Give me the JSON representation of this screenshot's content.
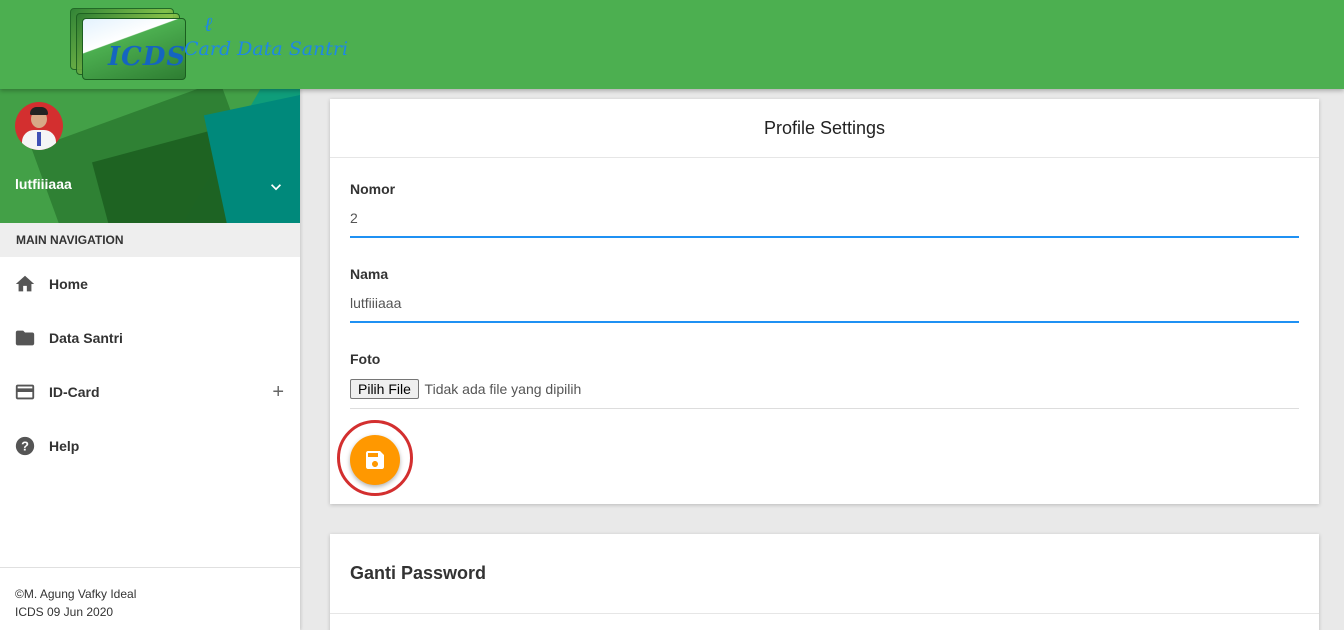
{
  "brand": {
    "logo_main": "ICDS",
    "logo_script": "Card Data Santri",
    "colors": {
      "topbar": "#4caf50",
      "accent": "#1f91f3",
      "fab": "#ff9800",
      "highlight_ring": "#d32f2f"
    }
  },
  "user": {
    "name": "lutfiiiaaa",
    "avatar_icon": "user-photo",
    "toggle_icon": "chevron-down-icon"
  },
  "sidebar": {
    "header": "MAIN NAVIGATION",
    "items": [
      {
        "label": "Home",
        "icon": "home-icon"
      },
      {
        "label": "Data Santri",
        "icon": "folder-icon"
      },
      {
        "label": "ID-Card",
        "icon": "credit-card-icon",
        "expand": "+"
      },
      {
        "label": "Help",
        "icon": "help-icon"
      }
    ],
    "footer": {
      "copyright": "©M. Agung Vafky Ideal",
      "date": "ICDS 09 Jun 2020"
    }
  },
  "profile_settings": {
    "title": "Profile Settings",
    "fields": {
      "nomor": {
        "label": "Nomor",
        "value": "2"
      },
      "nama": {
        "label": "Nama",
        "value": "lutfiiiaaa"
      },
      "foto": {
        "label": "Foto",
        "button": "Pilih File",
        "status": "Tidak ada file yang dipilih"
      }
    },
    "save_icon": "floppy-disk-icon"
  },
  "change_password": {
    "title": "Ganti Password"
  }
}
